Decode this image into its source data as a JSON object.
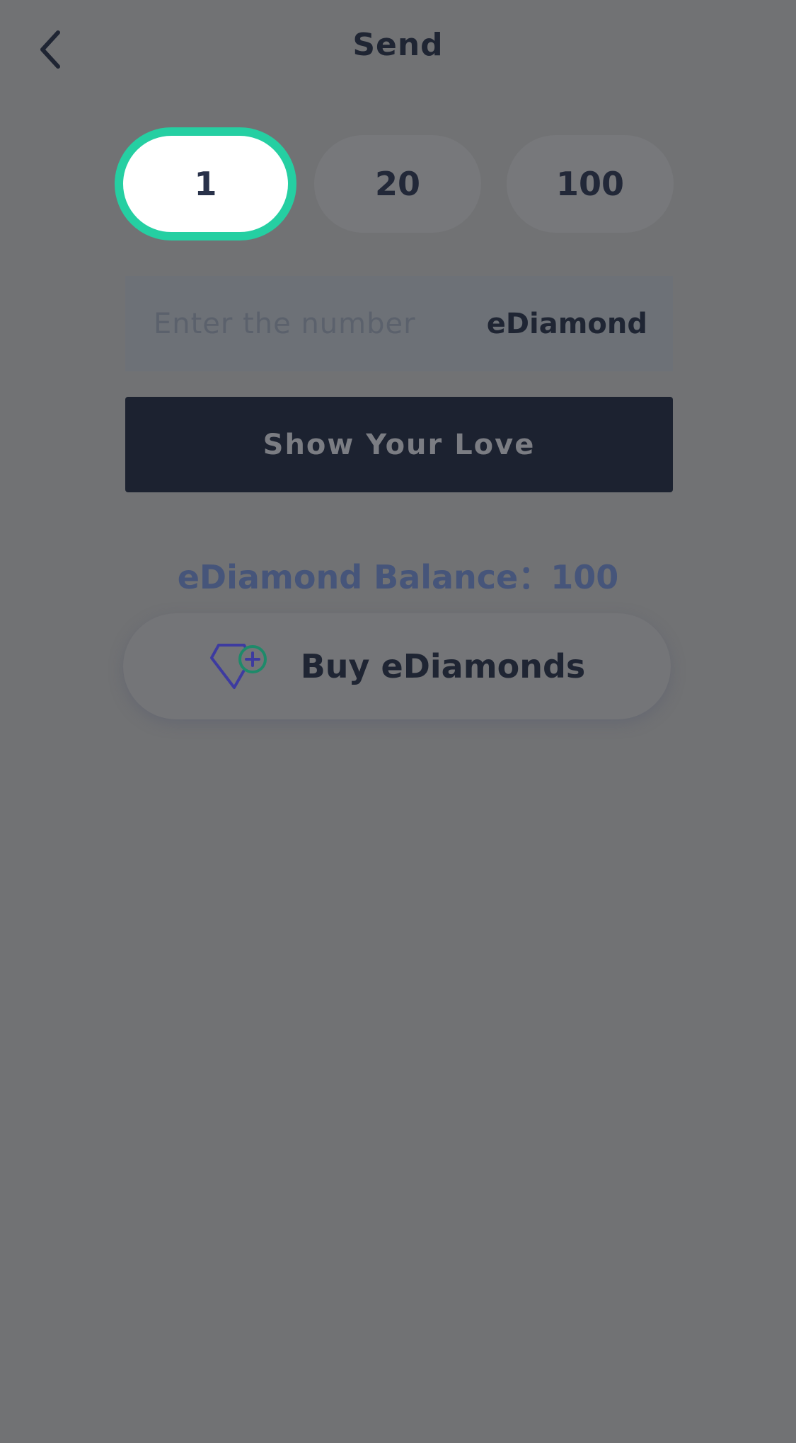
{
  "header": {
    "title": "Send"
  },
  "amounts": [
    {
      "label": "1",
      "selected": true
    },
    {
      "label": "20",
      "selected": false
    },
    {
      "label": "100",
      "selected": false
    }
  ],
  "input": {
    "placeholder": "Enter the number",
    "value": "",
    "unit": "eDiamond"
  },
  "send_button": {
    "label": "Show Your Love"
  },
  "balance": {
    "label": "eDiamond Balance：100"
  },
  "buy_button": {
    "label": "Buy eDiamonds",
    "icon": "diamond-plus-icon"
  },
  "colors": {
    "background": "#717274",
    "accent": "#25cfa2",
    "button_dark": "#1c2230",
    "balance_text": "#46557a",
    "icon_purple": "#3d3ba0",
    "icon_green": "#1e8a6a"
  }
}
